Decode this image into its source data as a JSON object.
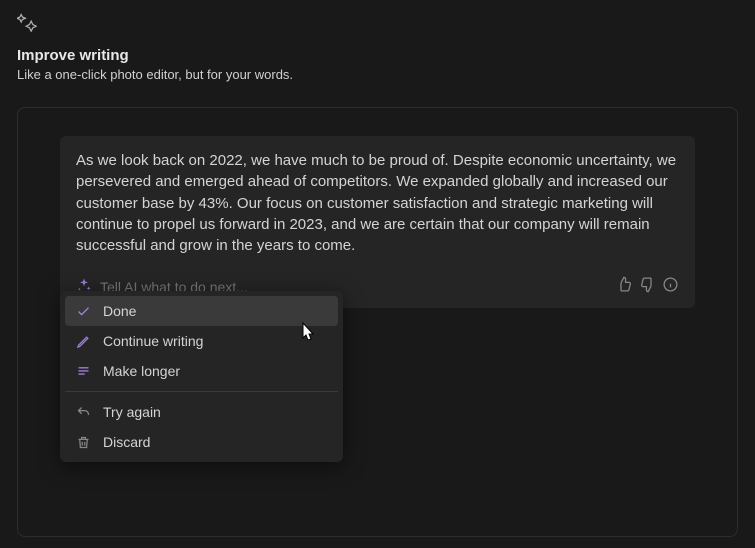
{
  "header": {
    "title": "Improve writing",
    "subtitle": "Like a one-click photo editor, but for your words."
  },
  "response": {
    "text": "As we look back on 2022, we have much to be proud of. Despite economic uncertainty, we persevered and emerged ahead of competitors. We expanded globally and increased our customer base by 43%. Our focus on customer satisfaction and strategic marketing will continue to propel us forward in 2023, and we are certain that our company will remain successful and grow in the years to come."
  },
  "prompt": {
    "placeholder": "Tell AI what to do next..."
  },
  "menu": {
    "done": "Done",
    "continue": "Continue writing",
    "longer": "Make longer",
    "tryagain": "Try again",
    "discard": "Discard"
  }
}
